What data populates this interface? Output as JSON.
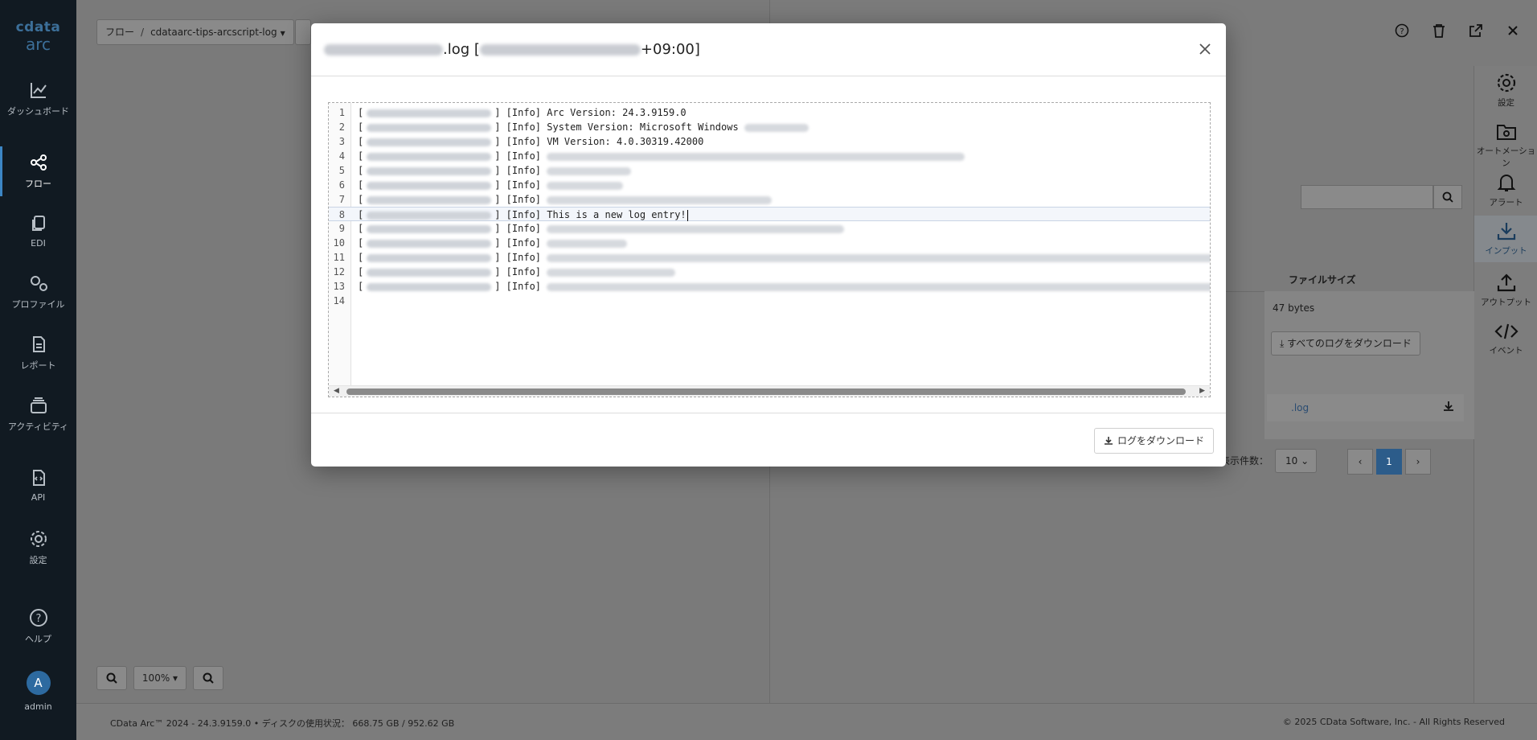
{
  "nav": {
    "brand_top": "cdata",
    "brand_bottom": "arc",
    "items": [
      {
        "label": "ダッシュボード",
        "icon": "chart-line-icon"
      },
      {
        "label": "フロー",
        "icon": "flow-icon",
        "active": true
      },
      {
        "label": "EDI",
        "icon": "copy-icon"
      },
      {
        "label": "プロファイル",
        "icon": "gears-icon"
      },
      {
        "label": "レポート",
        "icon": "document-icon"
      },
      {
        "label": "アクティビティ",
        "icon": "layers-icon"
      },
      {
        "label": "API",
        "icon": "code-file-icon"
      },
      {
        "label": "設定",
        "icon": "gear-icon"
      }
    ],
    "help": "ヘルプ",
    "user_initial": "A",
    "user": "admin"
  },
  "page": {
    "breadcrumb_root": "フロー",
    "breadcrumb_separator": "/",
    "breadcrumb_current": "cdataarc-tips-arcscript-log",
    "zoom": "100%",
    "footer_left": "CData Arc™ 2024 - 24.3.9159.0  •  ディスクの使用状況： 668.75 GB / 952.62 GB",
    "footer_right": "© 2025 CData Software, Inc. - All Rights Reserved"
  },
  "right_panel": {
    "side_tabs": [
      {
        "label": "設定",
        "icon": "gear-icon"
      },
      {
        "label": "オートメーション",
        "icon": "folder-gear-icon"
      },
      {
        "label": "アラート",
        "icon": "bell-icon"
      },
      {
        "label": "インプット",
        "icon": "download-icon",
        "active": true
      },
      {
        "label": "アウトプット",
        "icon": "upload-icon"
      },
      {
        "label": "イベント",
        "icon": "code-icon"
      }
    ],
    "column_header": "ファイルサイズ",
    "file_size": "47 bytes",
    "download_all_label": "すべてのログをダウンロード",
    "log_file_suffix": ".log",
    "page_size_label": "表示件数：",
    "page_size": "10",
    "current_page": "1"
  },
  "modal": {
    "title_suffix": ".log [",
    "title_offset": "+09:00]",
    "download_label": "ログをダウンロード",
    "log_lines": [
      {
        "num": "1",
        "text": "] [Info] Arc Version: 24.3.9159.0"
      },
      {
        "num": "2",
        "text": "] [Info] System Version: Microsoft Windows"
      },
      {
        "num": "3",
        "text": "] [Info] VM Version: 4.0.30319.42000"
      },
      {
        "num": "4",
        "text": "] [Info]"
      },
      {
        "num": "5",
        "text": "] [Info]"
      },
      {
        "num": "6",
        "text": "] [Info]"
      },
      {
        "num": "7",
        "text": "] [Info]"
      },
      {
        "num": "8",
        "text": "] [Info] This is a new log entry!"
      },
      {
        "num": "9",
        "text": "] [Info]"
      },
      {
        "num": "10",
        "text": "] [Info]"
      },
      {
        "num": "11",
        "text": "] [Info]"
      },
      {
        "num": "12",
        "text": "] [Info]"
      },
      {
        "num": "13",
        "text": "] [Info]"
      },
      {
        "num": "14",
        "text": ""
      }
    ]
  }
}
